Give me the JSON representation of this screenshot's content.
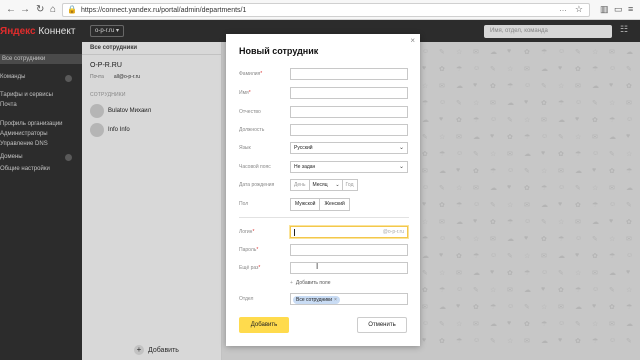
{
  "browser": {
    "url": "https://connect.yandex.ru/portal/admin/departments/1"
  },
  "sidebar": {
    "logo_brand": "Яндекс",
    "logo_product": "Коннект",
    "items": [
      {
        "label": "Все сотрудники"
      },
      {
        "label": "Команды"
      },
      {
        "label": "Тарифы и сервисы"
      },
      {
        "label": "Почта"
      },
      {
        "label": "Профиль организации"
      },
      {
        "label": "Администраторы"
      },
      {
        "label": "Управление DNS"
      },
      {
        "label": "Домены"
      },
      {
        "label": "Общие настройки"
      }
    ]
  },
  "topbar": {
    "org": "o-p-r.ru",
    "search_placeholder": "Имя, отдел, команда"
  },
  "list": {
    "header": "Все сотрудники",
    "org_name": "O-P-R.RU",
    "mail_label": "Почта",
    "mail_value": "all@o-p-r.ru",
    "section_label": "СОТРУДНИКИ",
    "people": [
      {
        "name": "Bulatov Михаил"
      },
      {
        "name": "Info Info"
      }
    ],
    "add_label": "Добавить"
  },
  "modal": {
    "title": "Новый сотрудник",
    "fields": {
      "last_name": "Фамилия",
      "first_name": "Имя",
      "patronymic": "Отчество",
      "position": "Должность",
      "language": "Язык",
      "language_value": "Русский",
      "timezone": "Часовой пояс",
      "timezone_value": "Не задан",
      "birthdate": "Дата рождения",
      "day": "День",
      "month": "Месяц",
      "year": "Год",
      "gender": "Пол",
      "male": "Мужской",
      "female": "Женский",
      "login": "Логин",
      "login_suffix": "@o-p-r.ru",
      "password": "Пароль",
      "password_repeat": "Ещё раз",
      "add_field": "Добавить поле",
      "department": "Отдел",
      "department_value": "Все сотрудники"
    },
    "submit": "Добавить",
    "cancel": "Отменить"
  }
}
